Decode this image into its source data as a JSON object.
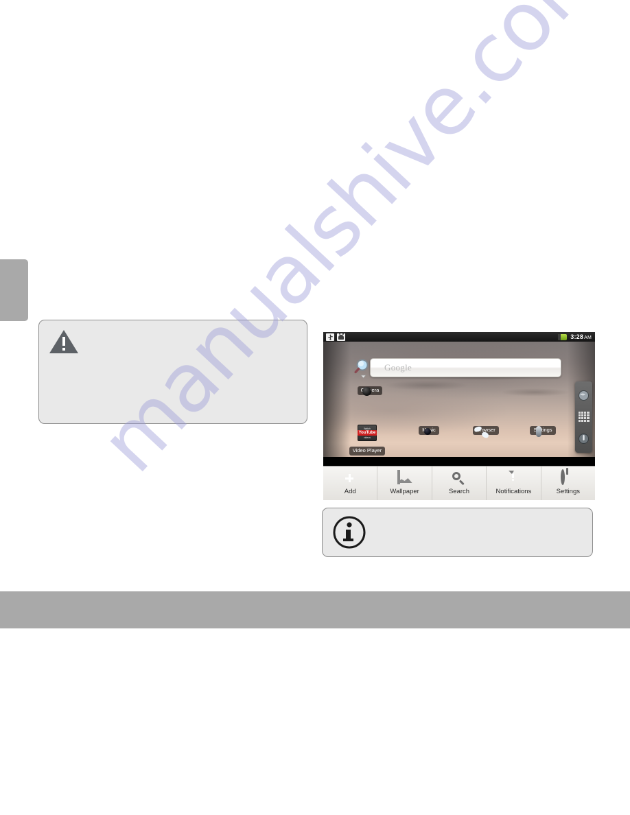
{
  "page": {
    "background_color": "#ffffff",
    "watermark_text": "manualshive.com",
    "watermark_color": "#9a9ad8",
    "footer_band_color": "#a9a9a9",
    "chapter_tab_color": "#a9a9a9"
  },
  "callouts": {
    "warning": {
      "icon": "warning-triangle-icon",
      "text": ""
    },
    "info": {
      "icon": "information-circle-icon",
      "text": ""
    }
  },
  "device_screenshot": {
    "statusbar": {
      "icons": [
        "usb-icon",
        "android-robot-icon"
      ],
      "battery_icon": "battery-icon",
      "battery_color": "#8fbf2a",
      "time": "3:28",
      "ampm": "AM"
    },
    "search_widget": {
      "icon": "search-magnifier-icon",
      "dropdown_icon": "chevron-down-icon",
      "placeholder": "Google",
      "value": ""
    },
    "home_icons": [
      {
        "label": "Camera",
        "icon": "camera-icon"
      },
      {
        "label": "Video Player",
        "icon": "video-player-icon"
      },
      {
        "label": "Music",
        "icon": "music-icon"
      },
      {
        "label": "Browser",
        "icon": "browser-icon"
      },
      {
        "label": "Settings",
        "icon": "settings-icon"
      }
    ],
    "side_dock": [
      {
        "name": "browser-shortcut",
        "icon": "globe-icon"
      },
      {
        "name": "app-drawer",
        "icon": "grid-icon"
      },
      {
        "name": "settings-shortcut",
        "icon": "settings-dial-icon"
      }
    ],
    "menu_bar": [
      {
        "label": "Add",
        "icon": "add-icon"
      },
      {
        "label": "Wallpaper",
        "icon": "wallpaper-icon"
      },
      {
        "label": "Search",
        "icon": "search-icon"
      },
      {
        "label": "Notifications",
        "icon": "notifications-icon"
      },
      {
        "label": "Settings",
        "icon": "settings-gear-icon"
      }
    ]
  }
}
